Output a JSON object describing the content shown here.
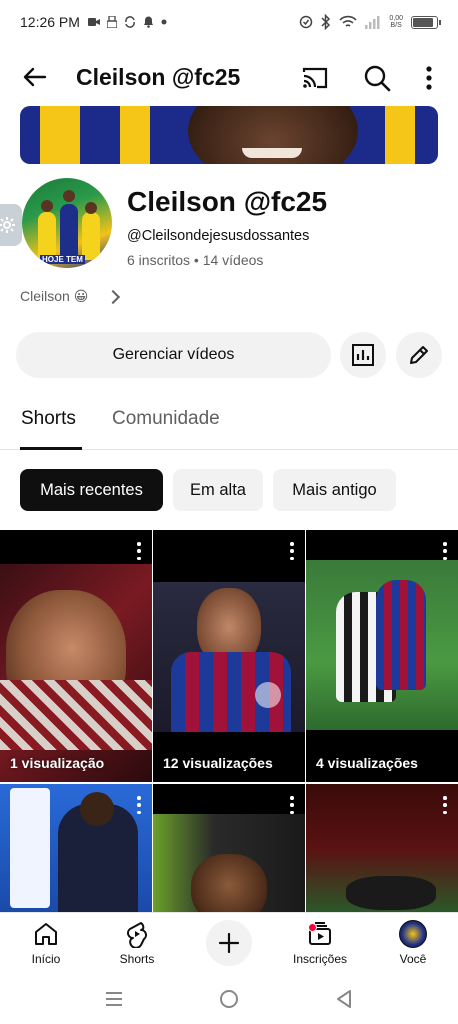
{
  "status_bar": {
    "time": "12:26 PM",
    "net_speed_value": "0,00",
    "net_speed_unit": "B/S"
  },
  "app_bar": {
    "title": "Cleilson @fc25"
  },
  "channel": {
    "name": "Cleilson @fc25",
    "handle": "@Cleilsondejesusdossantes",
    "stats": "6 inscritos • 14 vídeos",
    "description": "Cleilson 😀",
    "avatar_text": "HOJE TEM"
  },
  "actions": {
    "manage_videos": "Gerenciar vídeos"
  },
  "tabs": [
    {
      "label": "Shorts",
      "active": true
    },
    {
      "label": "Comunidade",
      "active": false
    }
  ],
  "chips": [
    {
      "label": "Mais recentes",
      "selected": true
    },
    {
      "label": "Em alta",
      "selected": false
    },
    {
      "label": "Mais antigo",
      "selected": false
    }
  ],
  "shorts": [
    {
      "views": "1 visualização"
    },
    {
      "views": "12 visualizações"
    },
    {
      "views": "4 visualizações"
    },
    {
      "views": ""
    },
    {
      "views": ""
    },
    {
      "views": ""
    }
  ],
  "bottom_nav": [
    {
      "label": "Início",
      "icon": "home-icon"
    },
    {
      "label": "Shorts",
      "icon": "shorts-icon"
    },
    {
      "label": "",
      "icon": "create-icon"
    },
    {
      "label": "Inscrições",
      "icon": "subscriptions-icon"
    },
    {
      "label": "Você",
      "icon": "you-avatar"
    }
  ],
  "colors": {
    "accent": "#0f0f0f",
    "chip_bg": "#f2f2f2",
    "secondary_text": "#606060",
    "notification": "#ff0033"
  }
}
